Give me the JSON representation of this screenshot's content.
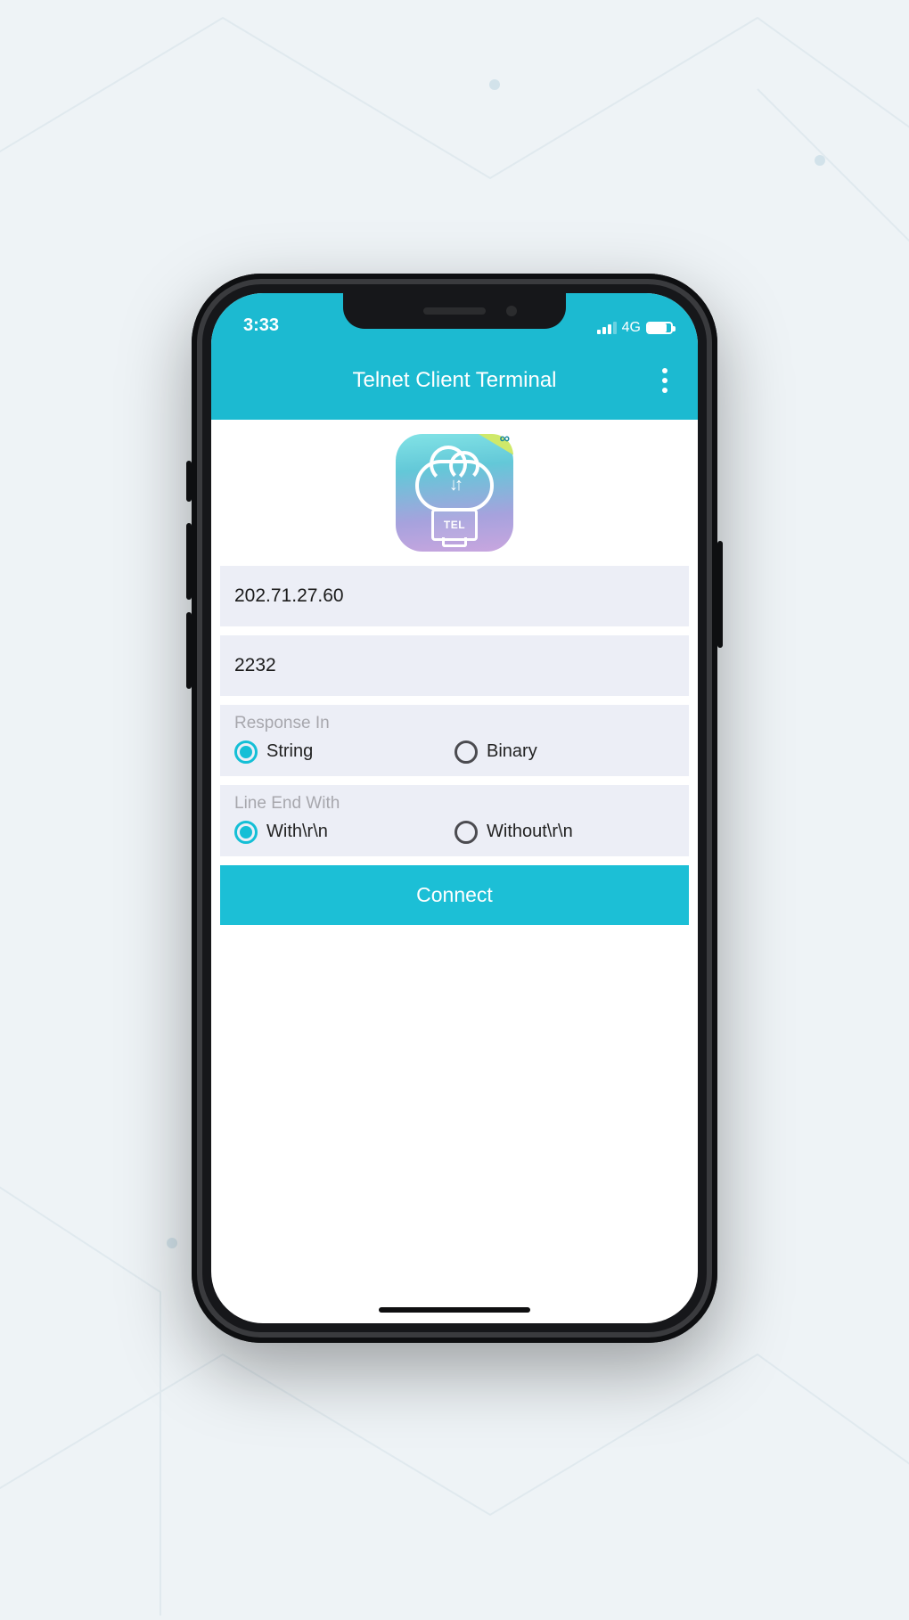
{
  "status": {
    "time": "3:33",
    "network_label": "4G"
  },
  "header": {
    "title": "Telnet Client Terminal"
  },
  "app_icon": {
    "name": "telnet-app-icon",
    "monitor_label": "TEL"
  },
  "fields": {
    "host": {
      "value": "202.71.27.60"
    },
    "port": {
      "value": "2232"
    }
  },
  "response_in": {
    "label": "Response In",
    "options": [
      {
        "label": "String",
        "selected": true
      },
      {
        "label": "Binary",
        "selected": false
      }
    ]
  },
  "line_end": {
    "label": "Line End With",
    "options": [
      {
        "label": "With\\r\\n",
        "selected": true
      },
      {
        "label": "Without\\r\\n",
        "selected": false
      }
    ]
  },
  "connect_button": {
    "label": "Connect"
  },
  "colors": {
    "accent": "#1cbad1",
    "accent2": "#14bfd6",
    "panel": "#eceef6"
  }
}
